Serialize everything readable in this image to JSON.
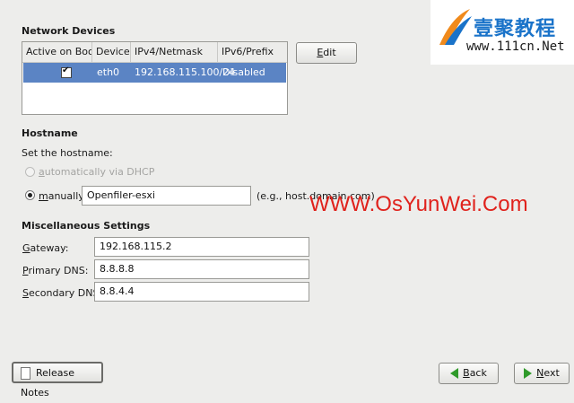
{
  "network": {
    "section_title": "Network Devices",
    "columns": [
      "Active on Boot",
      "Device",
      "IPv4/Netmask",
      "IPv6/Prefix"
    ],
    "rows": [
      {
        "active": true,
        "device": "eth0",
        "ipv4": "192.168.115.100/24",
        "ipv6": "Disabled"
      }
    ],
    "edit_label": "Edit",
    "edit_mnemonic": "E",
    "edit_rest": "dit"
  },
  "hostname": {
    "section_title": "Hostname",
    "prompt": "Set the hostname:",
    "dhcp_label": "automatically via DHCP",
    "dhcp_mnemonic": "a",
    "dhcp_rest": "utomatically via DHCP",
    "manual_mnemonic": "m",
    "manual_rest": "anually",
    "value": "Openfiler-esxi",
    "example": "(e.g., host.domain.com)"
  },
  "misc": {
    "section_title": "Miscellaneous Settings",
    "gateway_mnemonic": "G",
    "gateway_rest": "ateway:",
    "gateway_value": "192.168.115.2",
    "primary_mnemonic": "P",
    "primary_rest": "rimary DNS:",
    "primary_value": "8.8.8.8",
    "secondary_mnemonic": "S",
    "secondary_rest": "econdary DNS:",
    "secondary_value": "8.8.4.4"
  },
  "footer": {
    "release_notes_label": "Release Notes",
    "back_mnemonic": "B",
    "back_rest": "ack",
    "next_mnemonic": "N",
    "next_rest": "ext"
  },
  "watermark": {
    "logo_text": "壹聚教程",
    "logo_url": "www.111cn.Net",
    "overlay_text": "WWW.OsYunWei.Com"
  },
  "colors": {
    "selection": "#5b84c4",
    "overlay_red": "#e0221c",
    "logo_blue": "#1a73c9",
    "arrow_green": "#2f9a2a"
  },
  "icons": {
    "back": "left-arrow-icon",
    "next": "right-arrow-icon",
    "release_notes": "document-icon"
  }
}
